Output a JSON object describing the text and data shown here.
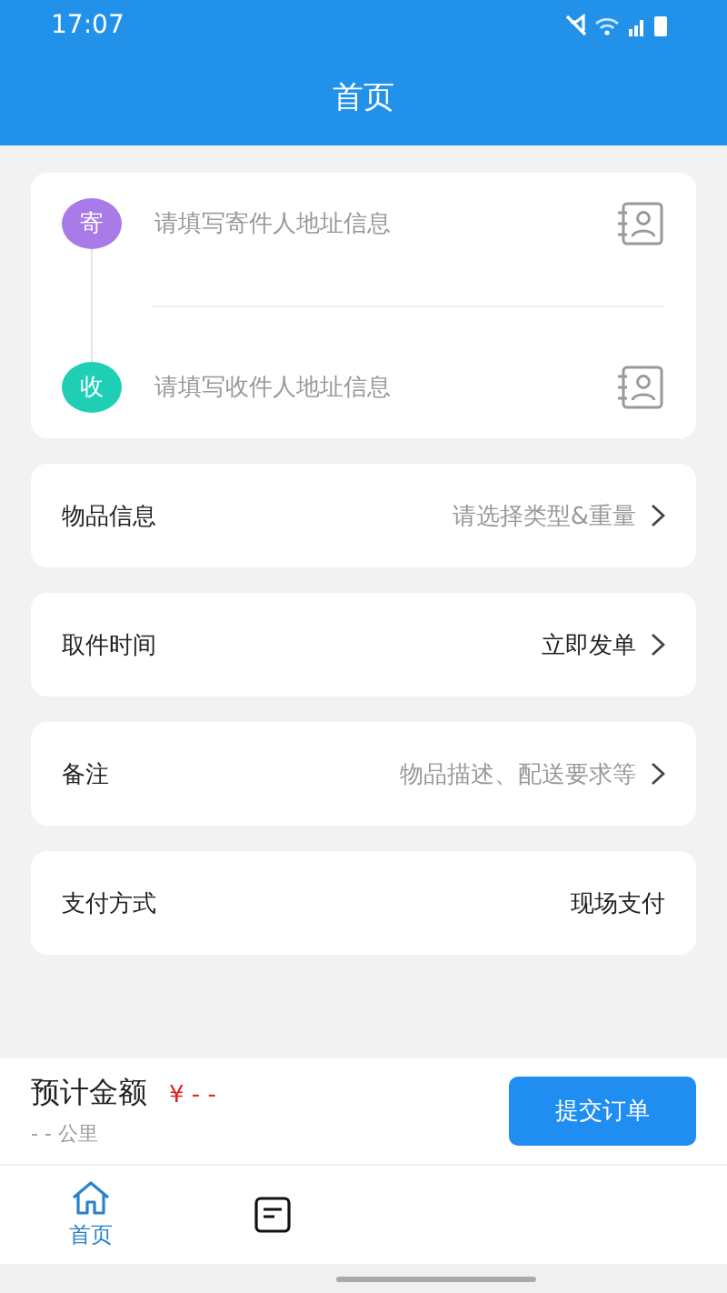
{
  "status_bar": {
    "time": "17:07"
  },
  "header": {
    "title": "首页"
  },
  "addresses": [
    {
      "badge": "寄",
      "color": "#a97be8",
      "placeholder": "请填写寄件人地址信息"
    },
    {
      "badge": "收",
      "color": "#1fcfb5",
      "placeholder": "请填写收件人地址信息"
    }
  ],
  "options": [
    {
      "label": "物品信息",
      "value": "请选择类型&重量",
      "placeholder": true,
      "chevron": true
    },
    {
      "label": "取件时间",
      "value": "立即发单",
      "placeholder": false,
      "chevron": true
    },
    {
      "label": "备注",
      "value": "物品描述、配送要求等",
      "placeholder": true,
      "chevron": true
    },
    {
      "label": "支付方式",
      "value": "现场支付",
      "placeholder": false,
      "chevron": false
    }
  ],
  "footer": {
    "price_label": "预计金额",
    "price": "¥ - -",
    "distance": "- - 公里",
    "submit": "提交订单"
  },
  "tabs": [
    {
      "label": "首页",
      "kind": "home",
      "selected": true
    },
    {
      "kind": "document",
      "selected": false
    }
  ]
}
